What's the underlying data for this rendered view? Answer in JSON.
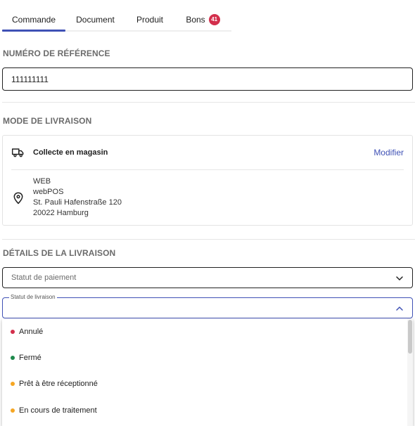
{
  "tabs": [
    {
      "label": "Commande",
      "active": true
    },
    {
      "label": "Document"
    },
    {
      "label": "Produit"
    },
    {
      "label": "Bons",
      "badge": "41"
    }
  ],
  "reference": {
    "title": "NUMÉRO DE RÉFÉRENCE",
    "value": "111111111"
  },
  "delivery_mode": {
    "title": "MODE DE LIVRAISON",
    "method": "Collecte en magasin",
    "modify_label": "Modifier",
    "address": [
      "WEB",
      "webPOS",
      "St. Pauli Hafenstraße 120",
      "20022 Hamburg"
    ]
  },
  "delivery_details": {
    "title": "DÉTAILS DE LA LIVRAISON",
    "payment_status_placeholder": "Statut de paiement",
    "delivery_status_label": "Statut de livraison",
    "options": [
      {
        "label": "Annulé",
        "color": "#d32f4c"
      },
      {
        "label": "Fermé",
        "color": "#1e8a4c"
      },
      {
        "label": "Prêt à être réceptionné",
        "color": "#f5a623"
      },
      {
        "label": "En cours de traitement",
        "color": "#f5a623"
      }
    ]
  },
  "colors": {
    "accent": "#3f51b5",
    "badge": "#d32f4c"
  }
}
